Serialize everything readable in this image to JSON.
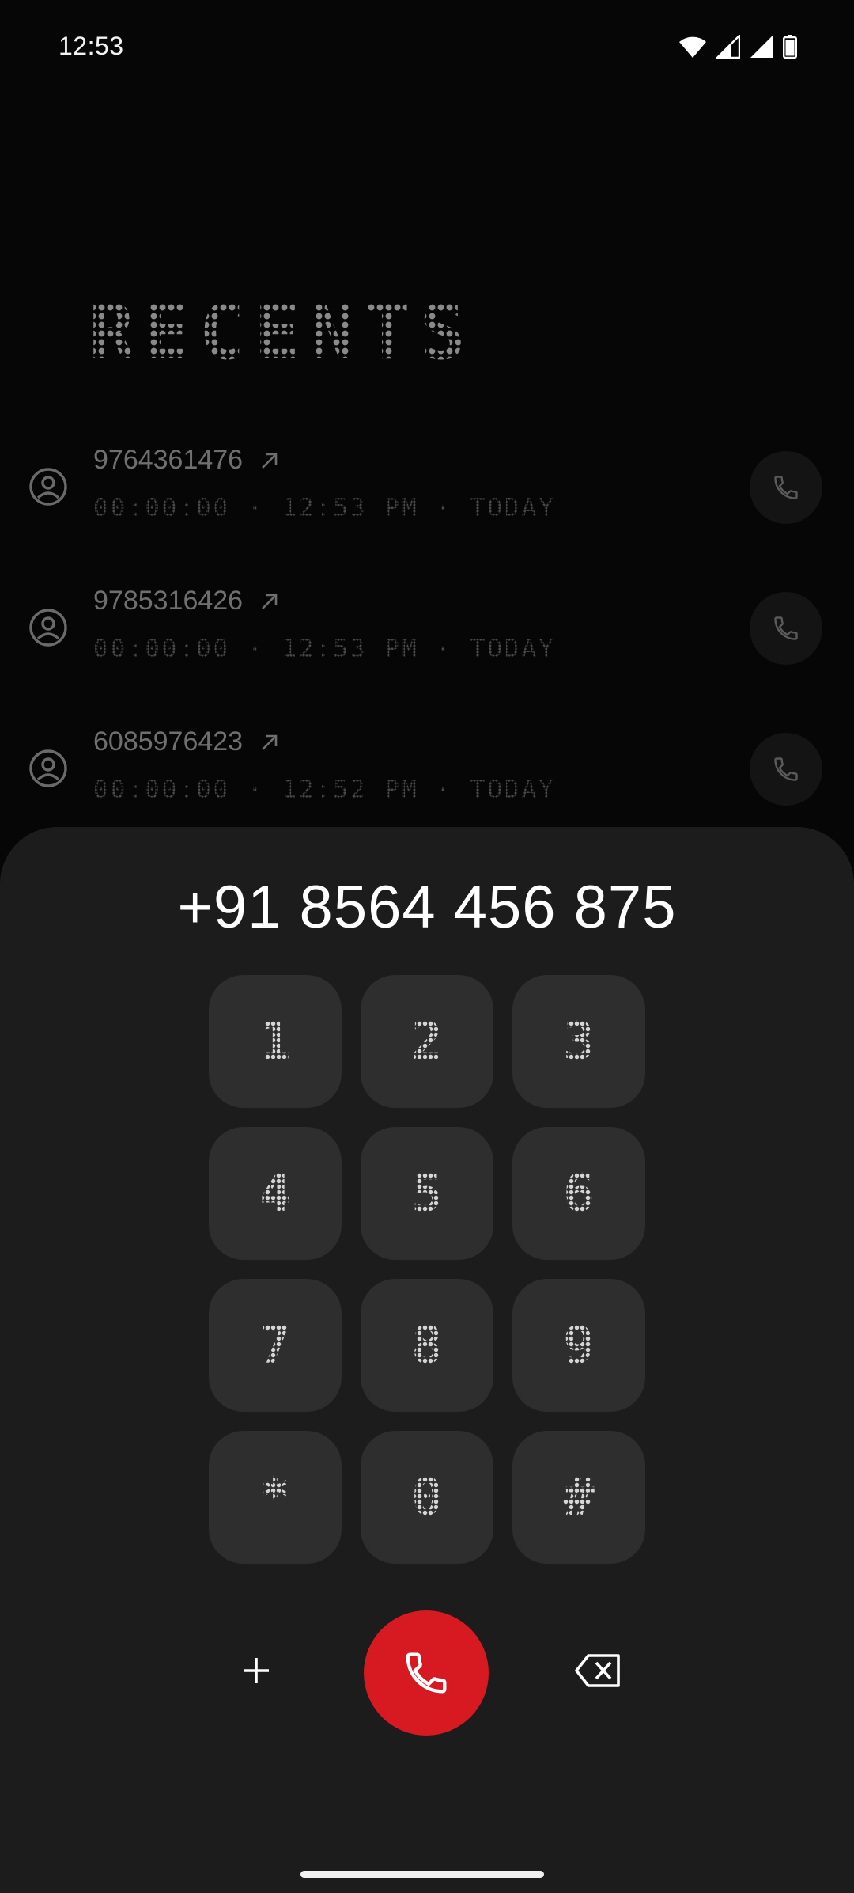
{
  "status_bar": {
    "time": "12:53",
    "icons": [
      "wifi-icon",
      "cell-signal-icon",
      "cell-signal-icon",
      "battery-icon"
    ]
  },
  "header": {
    "title": "RECENTS"
  },
  "recents": [
    {
      "number": "9764361476",
      "direction": "outgoing",
      "meta": "00:00:00 · 12:53 PM · TODAY"
    },
    {
      "number": "9785316426",
      "direction": "outgoing",
      "meta": "00:00:00 · 12:53 PM · TODAY"
    },
    {
      "number": "6085976423",
      "direction": "outgoing",
      "meta": "00:00:00 · 12:52 PM · TODAY"
    }
  ],
  "dialer": {
    "number": "+91 8564 456 875",
    "keys": [
      "1",
      "2",
      "3",
      "4",
      "5",
      "6",
      "7",
      "8",
      "9",
      "*",
      "0",
      "#"
    ],
    "add_label": "+",
    "call_color": "#d71921"
  },
  "colors": {
    "background": "#060606",
    "sheet": "#1c1c1c",
    "key": "#2e2e2e",
    "accent": "#d71921"
  }
}
